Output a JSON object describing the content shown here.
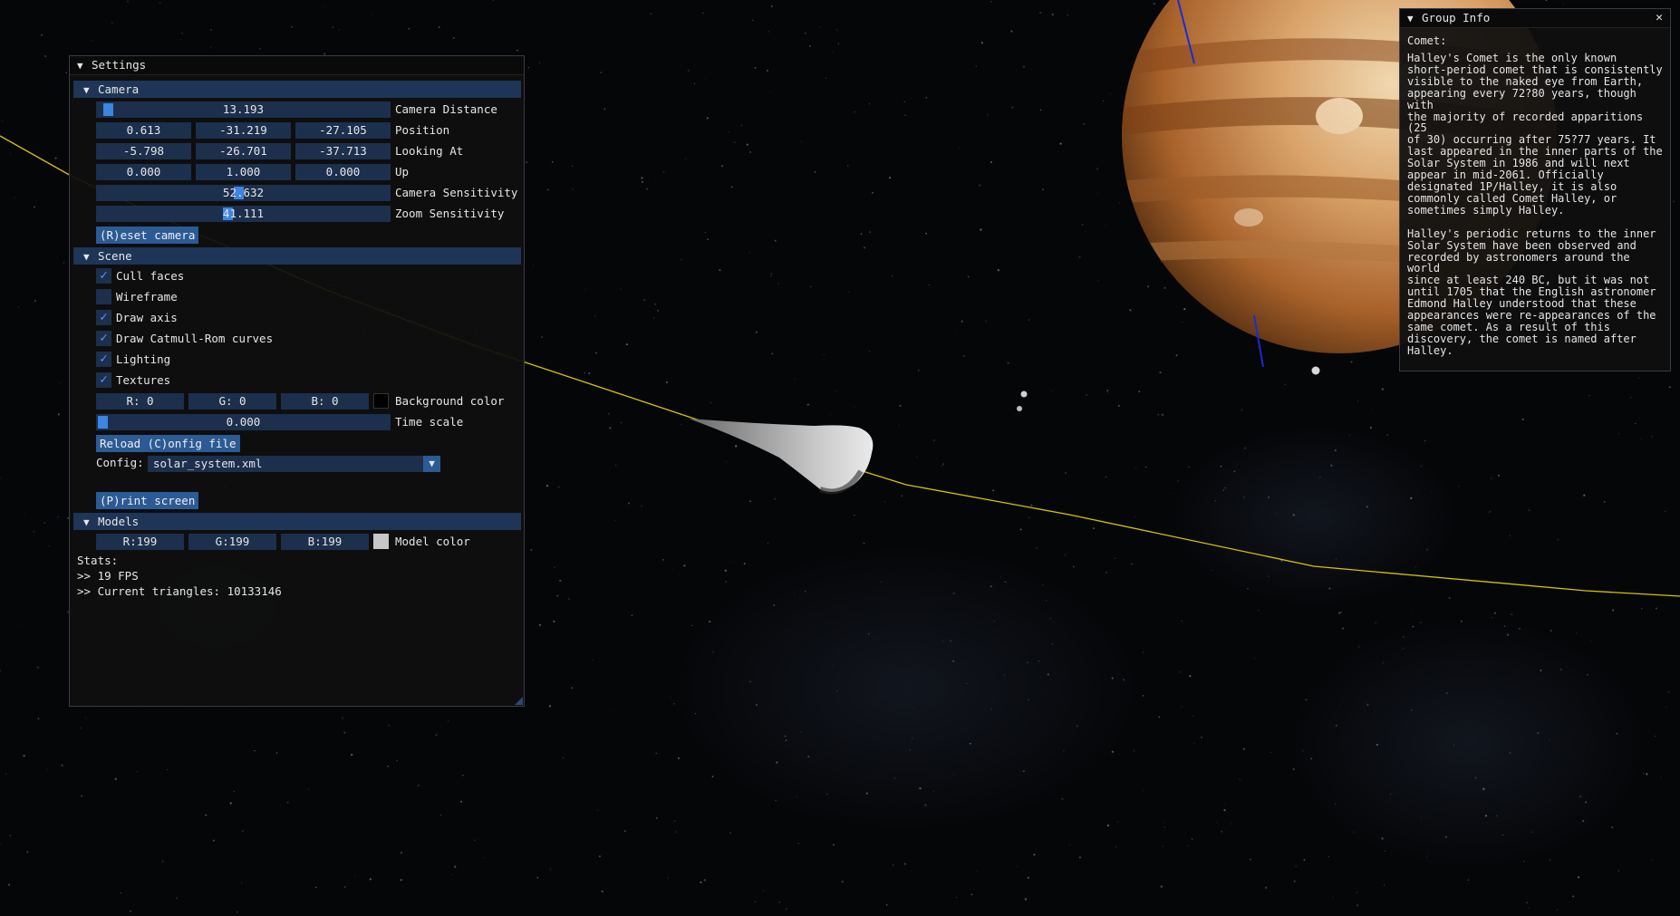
{
  "settings": {
    "title": "Settings",
    "camera": {
      "header": "Camera",
      "distance": {
        "value": "13.193",
        "label": "Camera Distance"
      },
      "position": {
        "x": "0.613",
        "y": "-31.219",
        "z": "-27.105",
        "label": "Position"
      },
      "looking_at": {
        "x": "-5.798",
        "y": "-26.701",
        "z": "-37.713",
        "label": "Looking At"
      },
      "up": {
        "x": "0.000",
        "y": "1.000",
        "z": "0.000",
        "label": "Up"
      },
      "sensitivity": {
        "value": "52.632",
        "label": "Camera Sensitivity"
      },
      "zoom_sensitivity": {
        "value": "41.111",
        "label": "Zoom Sensitivity"
      },
      "reset_label": "(R)eset camera"
    },
    "scene": {
      "header": "Scene",
      "checkboxes": [
        {
          "label": "Cull faces",
          "checked": true
        },
        {
          "label": "Wireframe",
          "checked": false
        },
        {
          "label": "Draw axis",
          "checked": true
        },
        {
          "label": "Draw Catmull-Rom curves",
          "checked": true
        },
        {
          "label": "Lighting",
          "checked": true
        },
        {
          "label": "Textures",
          "checked": true
        }
      ],
      "background": {
        "r": "R:  0",
        "g": "G:  0",
        "b": "B:  0",
        "label": "Background color",
        "color": "#000000"
      },
      "time_scale": {
        "value": "0.000",
        "label": "Time scale"
      },
      "reload_label": "Reload (C)onfig file",
      "config_label": "Config:",
      "config_value": "solar_system.xml",
      "print_label": "(P)rint screen"
    },
    "models": {
      "header": "Models",
      "color": {
        "r": "R:199",
        "g": "G:199",
        "b": "B:199",
        "label": "Model color",
        "value": "#c7c7c7"
      }
    },
    "stats": {
      "title": "Stats:",
      "fps": ">> 19 FPS",
      "triangles": ">> Current triangles: 10133146"
    }
  },
  "group_info": {
    "title": "Group Info",
    "close": "✕",
    "heading": "Comet:",
    "para1": "Halley's Comet is the only known\nshort-period comet that is consistently\nvisible to the naked eye from Earth,\nappearing every 72?80 years, though with\nthe majority of recorded apparitions (25\nof 30) occurring after 75?77 years. It\nlast appeared in the inner parts of the\nSolar System in 1986 and will next\nappear in mid-2061. Officially\ndesignated 1P/Halley, it is also\ncommonly called Comet Halley, or\nsometimes simply Halley.",
    "para2": "Halley's periodic returns to the inner\nSolar System have been observed and\nrecorded by astronomers around the world\nsince at least 240 BC, but it was not\nuntil 1705 that the English astronomer\nEdmond Halley understood that these\nappearances were re-appearances of the\nsame comet. As a result of this\ndiscovery, the comet is named after\nHalley."
  },
  "colors": {
    "header_bg": "#1e3558",
    "field_bg": "#1c2f4d",
    "button_bg": "#2c5a94",
    "accent": "#3d85e0",
    "orbit_line": "#d8c300",
    "axis_line": "#1a2ad8"
  }
}
